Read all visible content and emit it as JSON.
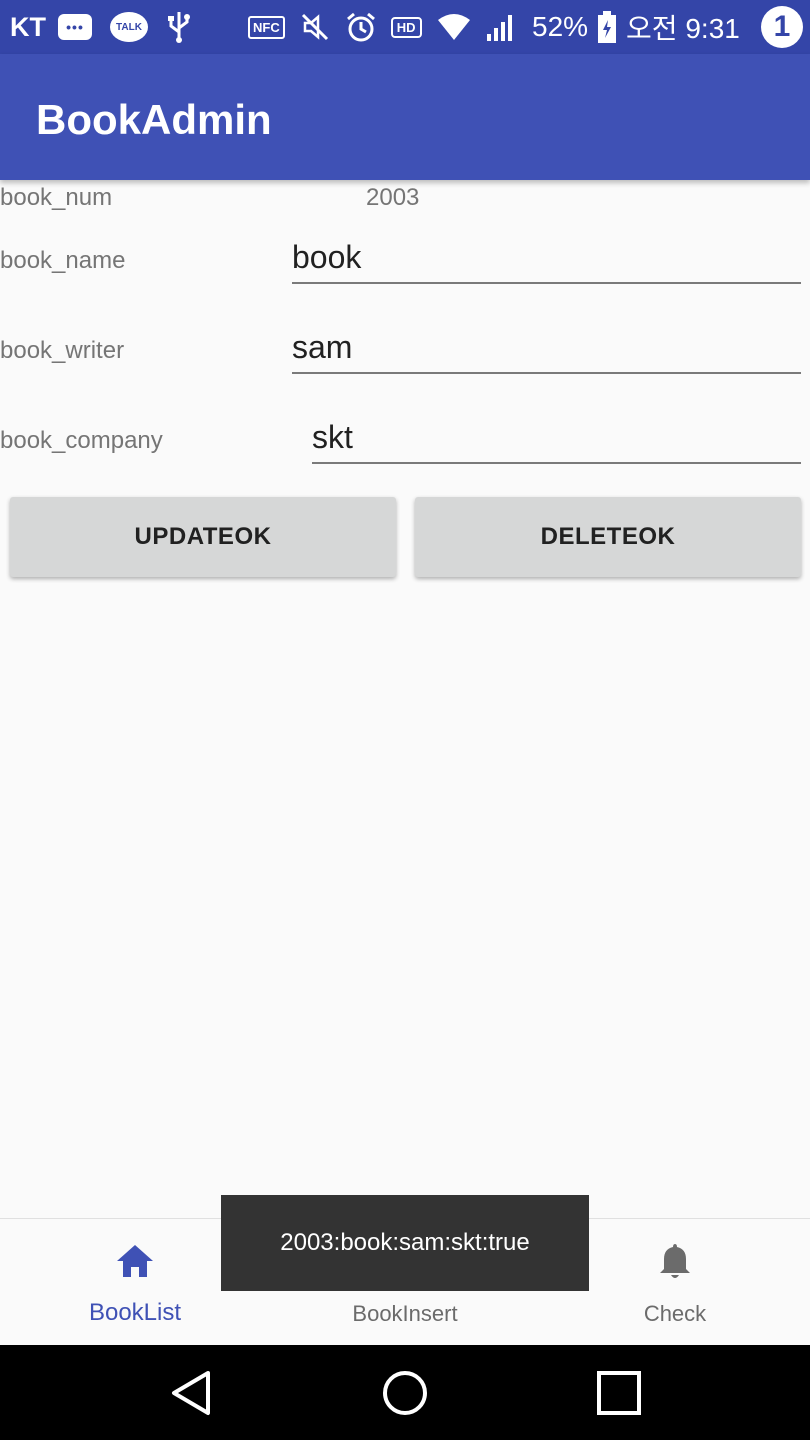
{
  "status_bar": {
    "carrier": "KT",
    "talk_label": "TALK",
    "nfc_label": "NFC",
    "hd_label": "HD",
    "battery": "52%",
    "time": "오전 9:31",
    "badge_count": "1"
  },
  "app_bar": {
    "title": "BookAdmin"
  },
  "form": {
    "book_num_label": "book_num",
    "book_num_value": "2003",
    "book_name_label": "book_name",
    "book_name_value": "book",
    "book_writer_label": "book_writer",
    "book_writer_value": "sam",
    "book_company_label": "book_company",
    "book_company_value": "skt"
  },
  "buttons": {
    "update": "UPDATEOK",
    "delete": "DELETEOK"
  },
  "bottom_nav": {
    "items": [
      {
        "label": "BookList",
        "icon": "home-icon",
        "active": true
      },
      {
        "label": "BookInsert",
        "icon": "dashboard-icon",
        "active": false
      },
      {
        "label": "Check",
        "icon": "bell-icon",
        "active": false
      }
    ]
  },
  "toast": {
    "message": "2003:book:sam:skt:true"
  },
  "colors": {
    "primary": "#3f51b5",
    "status_bar": "#3445a8",
    "button": "#d6d7d7",
    "toast": "#333333"
  }
}
